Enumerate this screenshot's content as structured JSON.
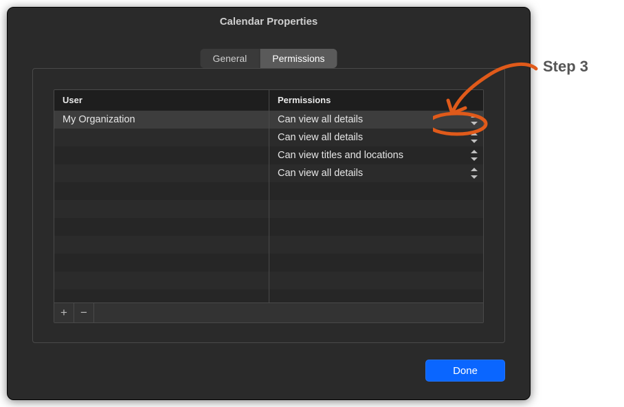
{
  "window": {
    "title": "Calendar Properties"
  },
  "tabs": {
    "general": "General",
    "permissions": "Permissions",
    "active": "permissions"
  },
  "columns": {
    "user": "User",
    "perm": "Permissions"
  },
  "rows": [
    {
      "user": "My Organization",
      "perm": "Can view all details",
      "selected": true
    },
    {
      "user": "",
      "perm": "Can view all details",
      "selected": false
    },
    {
      "user": "",
      "perm": "Can view titles and locations",
      "selected": false
    },
    {
      "user": "",
      "perm": "Can view all details",
      "selected": false
    }
  ],
  "buttons": {
    "add": "+",
    "remove": "−",
    "done": "Done"
  },
  "annotation": {
    "step_label": "Step 3"
  }
}
